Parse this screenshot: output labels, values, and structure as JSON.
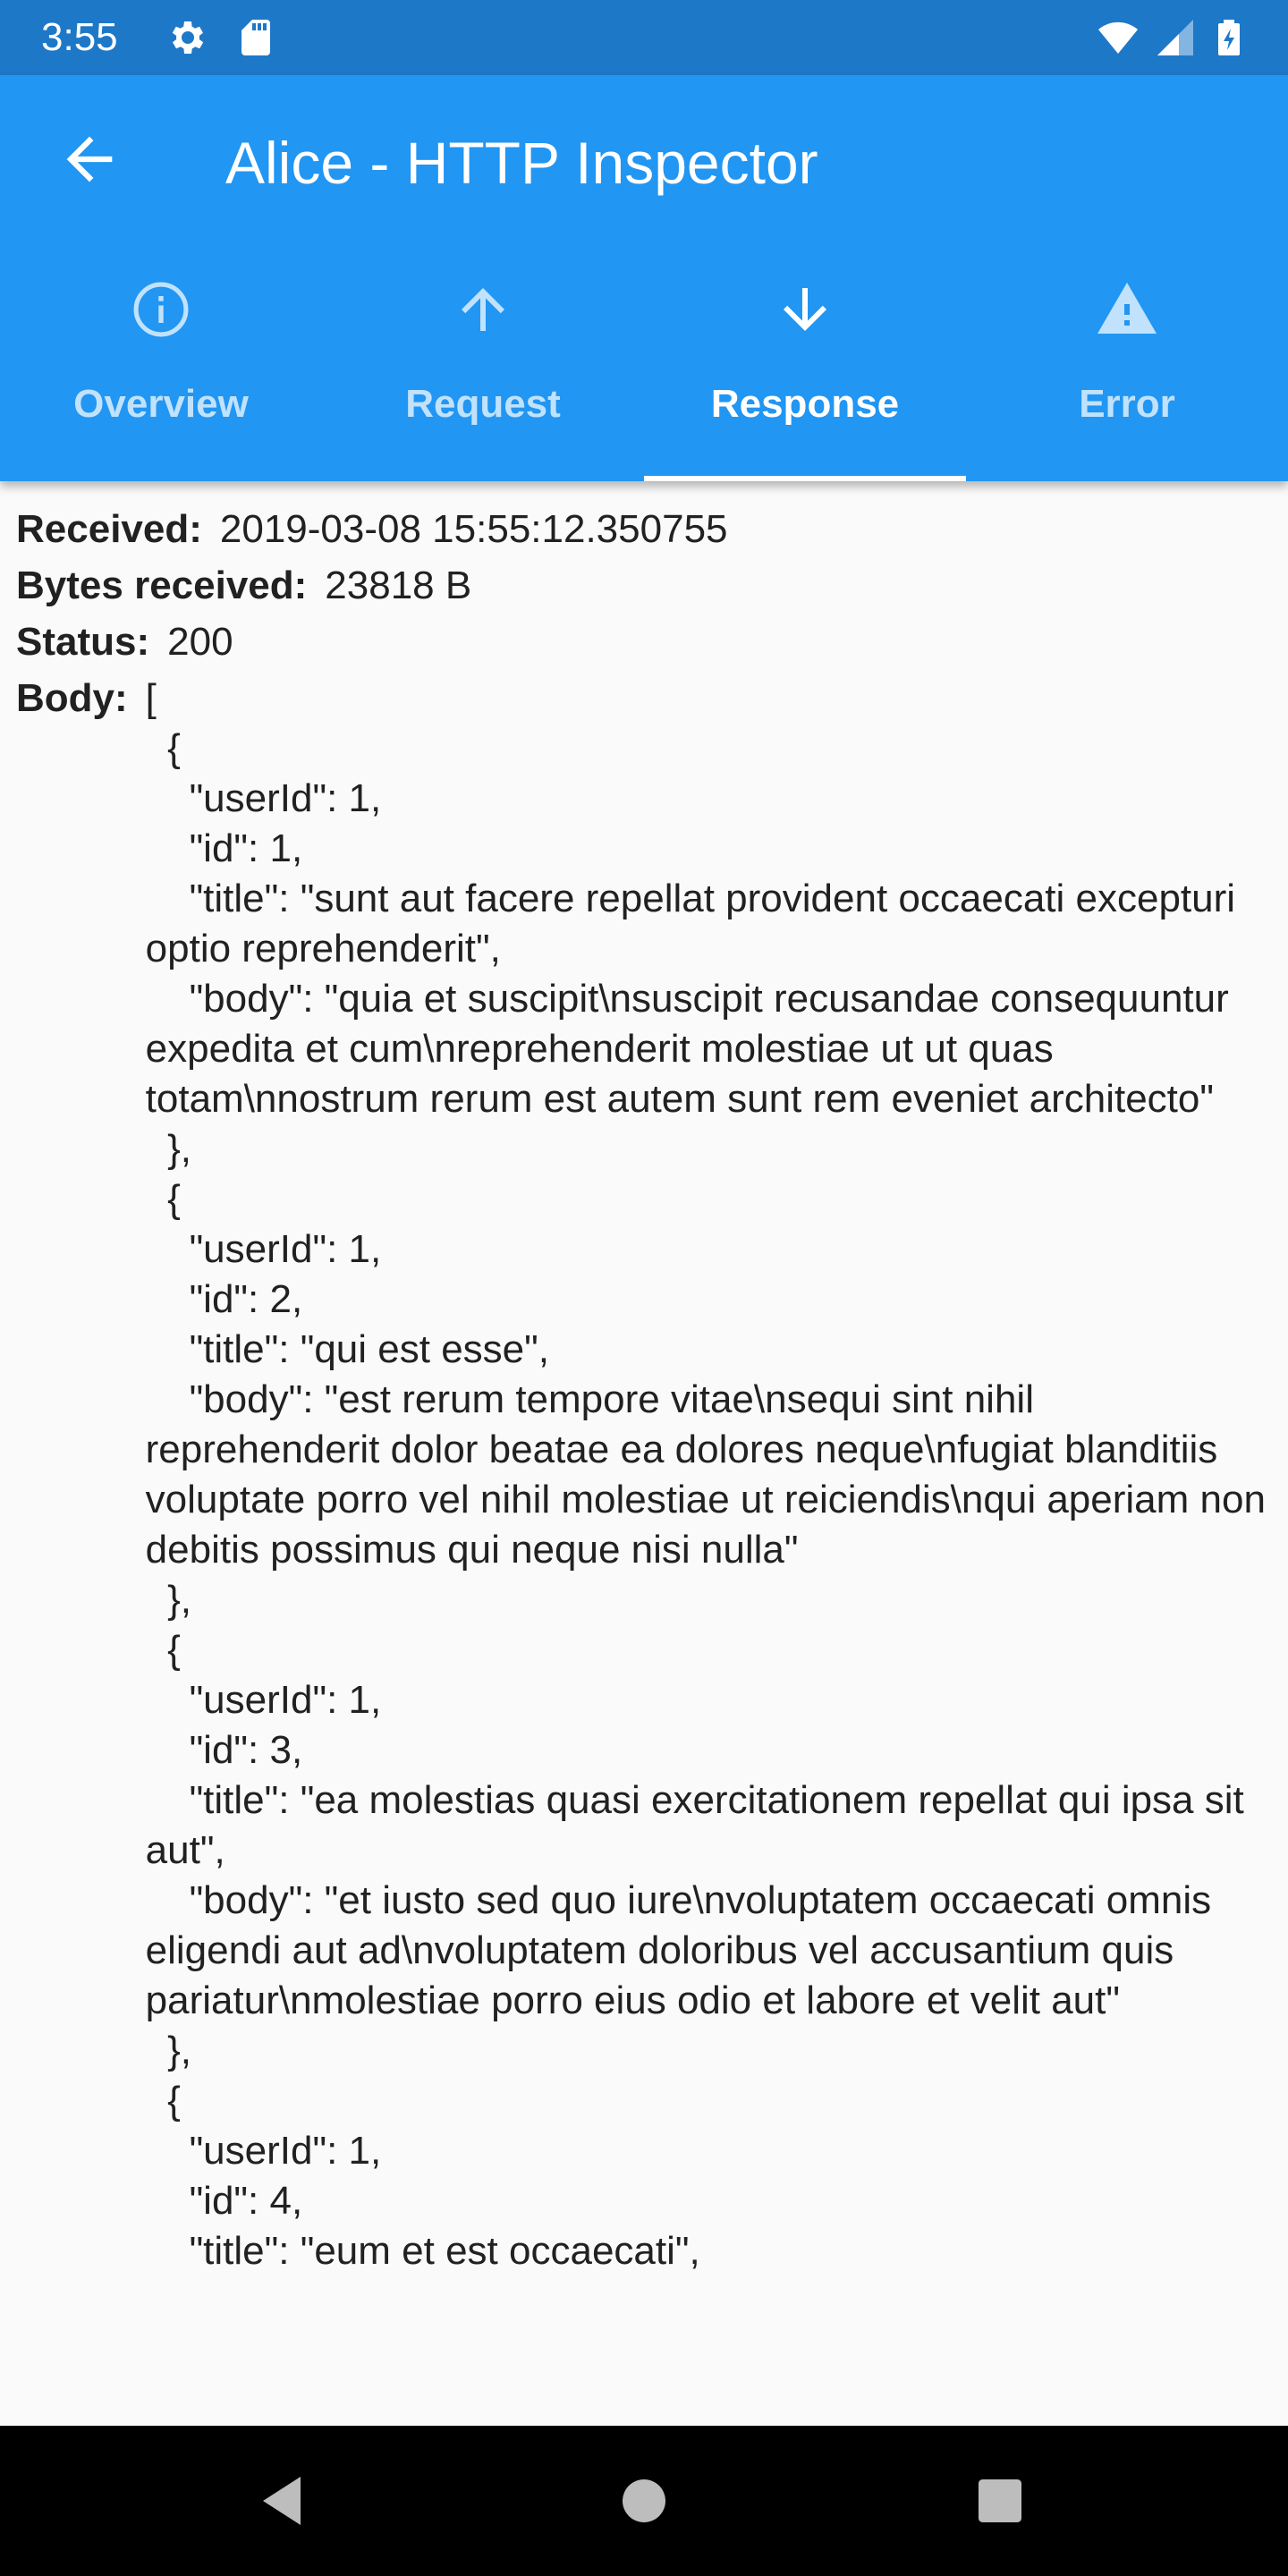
{
  "status_bar": {
    "time": "3:55"
  },
  "app_bar": {
    "title": "Alice - HTTP Inspector"
  },
  "tabs": [
    {
      "label": "Overview",
      "icon": "info-icon"
    },
    {
      "label": "Request",
      "icon": "arrow-up-icon"
    },
    {
      "label": "Response",
      "icon": "arrow-down-icon",
      "active": true
    },
    {
      "label": "Error",
      "icon": "warning-icon"
    }
  ],
  "response": {
    "received_label": "Received:",
    "received_value": "2019-03-08 15:55:12.350755",
    "bytes_label": "Bytes received:",
    "bytes_value": "23818 B",
    "status_label": "Status:",
    "status_value": "200",
    "body_label": "Body:",
    "body_value": "[\n  {\n    \"userId\": 1,\n    \"id\": 1,\n    \"title\": \"sunt aut facere repellat provident occaecati excepturi optio reprehenderit\",\n    \"body\": \"quia et suscipit\\nsuscipit recusandae consequuntur expedita et cum\\nreprehenderit molestiae ut ut quas totam\\nnostrum rerum est autem sunt rem eveniet architecto\"\n  },\n  {\n    \"userId\": 1,\n    \"id\": 2,\n    \"title\": \"qui est esse\",\n    \"body\": \"est rerum tempore vitae\\nsequi sint nihil reprehenderit dolor beatae ea dolores neque\\nfugiat blanditiis voluptate porro vel nihil molestiae ut reiciendis\\nqui aperiam non debitis possimus qui neque nisi nulla\"\n  },\n  {\n    \"userId\": 1,\n    \"id\": 3,\n    \"title\": \"ea molestias quasi exercitationem repellat qui ipsa sit aut\",\n    \"body\": \"et iusto sed quo iure\\nvoluptatem occaecati omnis eligendi aut ad\\nvoluptatem doloribus vel accusantium quis pariatur\\nmolestiae porro eius odio et labore et velit aut\"\n  },\n  {\n    \"userId\": 1,\n    \"id\": 4,\n    \"title\": \"eum et est occaecati\","
  },
  "colors": {
    "status_bar": "#1e78c8",
    "app_bar": "#2196f3",
    "background": "#fafafa",
    "nav_bar": "#000000"
  }
}
